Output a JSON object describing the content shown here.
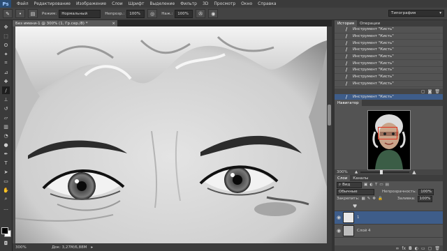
{
  "app": {
    "logo": "Ps"
  },
  "menu": [
    "Файл",
    "Редактирование",
    "Изображение",
    "Слои",
    "Шрифт",
    "Выделение",
    "Фильтр",
    "3D",
    "Просмотр",
    "Окно",
    "Справка"
  ],
  "options": {
    "mode_label": "Режим:",
    "mode_value": "Нормальный",
    "opacity_label": "Непрозр.:",
    "opacity_value": "100%",
    "pressure_label": "Наж.:",
    "pressure_value": "100%",
    "workspace": "Типография"
  },
  "document": {
    "tab_title": "Без имени-1 @ 300% (1, Гр.сер./8) *",
    "tab_close": "×",
    "zoom": "300%",
    "doc_info": "Док: 3,27М/6,88М"
  },
  "history": {
    "tabs": [
      "История",
      "Операции"
    ],
    "step_label": "Инструмент \"Кисть\"",
    "step_count": 11,
    "selected_index": 10
  },
  "navigator": {
    "title": "Навигатор",
    "zoom": "300%"
  },
  "layers": {
    "tabs": [
      "Слои",
      "Каналы"
    ],
    "filter_kind": "Вид",
    "blend_mode": "Обычные",
    "opacity_label": "Непрозрачность:",
    "opacity_value": "100%",
    "lock_label": "Закрепить:",
    "fill_label": "Заливка:",
    "fill_value": "100%",
    "items": [
      {
        "name": "1"
      },
      {
        "name": "Слой 4"
      }
    ]
  },
  "colors": {
    "accent": "#3e5d8a",
    "logo_bg": "#2a4d74",
    "nav_rect": "#e0301e"
  }
}
